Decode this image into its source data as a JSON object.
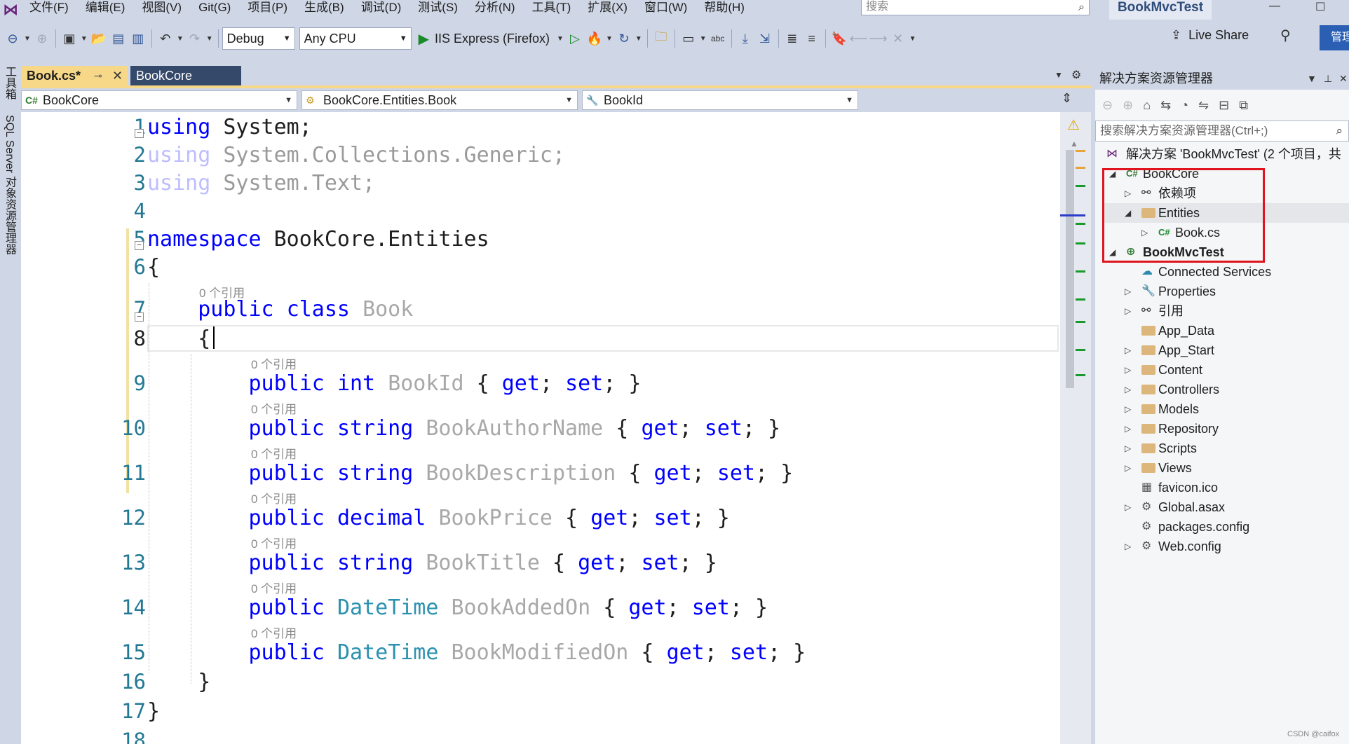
{
  "menu": [
    "文件(F)",
    "编辑(E)",
    "视图(V)",
    "Git(G)",
    "项目(P)",
    "生成(B)",
    "调试(D)",
    "测试(S)",
    "分析(N)",
    "工具(T)",
    "扩展(X)",
    "窗口(W)",
    "帮助(H)"
  ],
  "search_placeholder": "搜索",
  "solution_name": "BookMvcTest",
  "toolbar": {
    "config": "Debug",
    "platform": "Any CPU",
    "run_target": "IIS Express (Firefox)",
    "live_share": "Live Share",
    "admin": "管理"
  },
  "left_strip": [
    "工具箱",
    "SQL Server 对象资源管理器"
  ],
  "tabs": [
    {
      "label": "Book.cs*",
      "active": true
    },
    {
      "label": "BookCore",
      "active": false
    }
  ],
  "navbar": {
    "project": "BookCore",
    "type": "BookCore.Entities.Book",
    "member": "BookId"
  },
  "code_lens": "0 个引用",
  "code_lines": [
    {
      "n": "1",
      "segs": [
        [
          "kw",
          "using"
        ],
        [
          "t",
          " System;"
        ]
      ]
    },
    {
      "n": "2",
      "segs": [
        [
          "dimkw",
          "using"
        ],
        [
          "dim",
          " System.Collections.Generic;"
        ]
      ]
    },
    {
      "n": "3",
      "segs": [
        [
          "dimkw",
          "using"
        ],
        [
          "dim",
          " System.Text;"
        ]
      ]
    },
    {
      "n": "4",
      "segs": []
    },
    {
      "n": "5",
      "segs": [
        [
          "kw",
          "namespace"
        ],
        [
          "t",
          " BookCore.Entities"
        ]
      ]
    },
    {
      "n": "6",
      "segs": [
        [
          "t",
          "{"
        ]
      ]
    },
    {
      "n": "7",
      "segs": [
        [
          "t",
          "    "
        ],
        [
          "kw",
          "public"
        ],
        [
          "t",
          " "
        ],
        [
          "kw",
          "class"
        ],
        [
          "t",
          " "
        ],
        [
          "prop",
          "Book"
        ]
      ]
    },
    {
      "n": "8",
      "segs": [
        [
          "t",
          "    {"
        ]
      ]
    },
    {
      "n": "9",
      "segs": [
        [
          "t",
          "        "
        ],
        [
          "kw",
          "public"
        ],
        [
          "t",
          " "
        ],
        [
          "kw",
          "int"
        ],
        [
          "t",
          " "
        ],
        [
          "prop",
          "BookId"
        ],
        [
          "t",
          " { "
        ],
        [
          "kw",
          "get"
        ],
        [
          "t",
          "; "
        ],
        [
          "kw",
          "set"
        ],
        [
          "t",
          "; }"
        ]
      ]
    },
    {
      "n": "10",
      "segs": [
        [
          "t",
          "        "
        ],
        [
          "kw",
          "public"
        ],
        [
          "t",
          " "
        ],
        [
          "kw",
          "string"
        ],
        [
          "t",
          " "
        ],
        [
          "prop",
          "BookAuthorName"
        ],
        [
          "t",
          " { "
        ],
        [
          "kw",
          "get"
        ],
        [
          "t",
          "; "
        ],
        [
          "kw",
          "set"
        ],
        [
          "t",
          "; }"
        ]
      ]
    },
    {
      "n": "11",
      "segs": [
        [
          "t",
          "        "
        ],
        [
          "kw",
          "public"
        ],
        [
          "t",
          " "
        ],
        [
          "kw",
          "string"
        ],
        [
          "t",
          " "
        ],
        [
          "prop",
          "BookDescription"
        ],
        [
          "t",
          " { "
        ],
        [
          "kw",
          "get"
        ],
        [
          "t",
          "; "
        ],
        [
          "kw",
          "set"
        ],
        [
          "t",
          "; }"
        ]
      ]
    },
    {
      "n": "12",
      "segs": [
        [
          "t",
          "        "
        ],
        [
          "kw",
          "public"
        ],
        [
          "t",
          " "
        ],
        [
          "kw",
          "decimal"
        ],
        [
          "t",
          " "
        ],
        [
          "prop",
          "BookPrice"
        ],
        [
          "t",
          " { "
        ],
        [
          "kw",
          "get"
        ],
        [
          "t",
          "; "
        ],
        [
          "kw",
          "set"
        ],
        [
          "t",
          "; }"
        ]
      ]
    },
    {
      "n": "13",
      "segs": [
        [
          "t",
          "        "
        ],
        [
          "kw",
          "public"
        ],
        [
          "t",
          " "
        ],
        [
          "kw",
          "string"
        ],
        [
          "t",
          " "
        ],
        [
          "prop",
          "BookTitle"
        ],
        [
          "t",
          " { "
        ],
        [
          "kw",
          "get"
        ],
        [
          "t",
          "; "
        ],
        [
          "kw",
          "set"
        ],
        [
          "t",
          "; }"
        ]
      ]
    },
    {
      "n": "14",
      "segs": [
        [
          "t",
          "        "
        ],
        [
          "kw",
          "public"
        ],
        [
          "t",
          " "
        ],
        [
          "type",
          "DateTime"
        ],
        [
          "t",
          " "
        ],
        [
          "prop",
          "BookAddedOn"
        ],
        [
          "t",
          " { "
        ],
        [
          "kw",
          "get"
        ],
        [
          "t",
          "; "
        ],
        [
          "kw",
          "set"
        ],
        [
          "t",
          "; }"
        ]
      ]
    },
    {
      "n": "15",
      "segs": [
        [
          "t",
          "        "
        ],
        [
          "kw",
          "public"
        ],
        [
          "t",
          " "
        ],
        [
          "type",
          "DateTime"
        ],
        [
          "t",
          " "
        ],
        [
          "prop",
          "BookModifiedOn"
        ],
        [
          "t",
          " { "
        ],
        [
          "kw",
          "get"
        ],
        [
          "t",
          "; "
        ],
        [
          "kw",
          "set"
        ],
        [
          "t",
          "; }"
        ]
      ]
    },
    {
      "n": "16",
      "segs": [
        [
          "t",
          "    }"
        ]
      ]
    },
    {
      "n": "17",
      "segs": [
        [
          "t",
          "}"
        ]
      ]
    },
    {
      "n": "18",
      "segs": []
    }
  ],
  "solution_explorer": {
    "title": "解决方案资源管理器",
    "search_placeholder": "搜索解决方案资源管理器(Ctrl+;)",
    "solution_label": "解决方案 'BookMvcTest' (2 个项目，共",
    "items": [
      {
        "label": "BookCore",
        "icon": "csharp-project-icon"
      },
      {
        "label": "依赖项",
        "icon": "dependencies-icon"
      },
      {
        "label": "Entities",
        "icon": "folder-icon"
      },
      {
        "label": "Book.cs",
        "icon": "csharp-file-icon"
      },
      {
        "label": "BookMvcTest",
        "icon": "web-project-icon"
      },
      {
        "label": "Connected Services",
        "icon": "connected-services-icon"
      },
      {
        "label": "Properties",
        "icon": "wrench-icon"
      },
      {
        "label": "引用",
        "icon": "references-icon"
      },
      {
        "label": "App_Data",
        "icon": "folder-icon"
      },
      {
        "label": "App_Start",
        "icon": "folder-icon"
      },
      {
        "label": "Content",
        "icon": "folder-icon"
      },
      {
        "label": "Controllers",
        "icon": "folder-icon"
      },
      {
        "label": "Models",
        "icon": "folder-icon"
      },
      {
        "label": "Repository",
        "icon": "folder-icon"
      },
      {
        "label": "Scripts",
        "icon": "folder-icon"
      },
      {
        "label": "Views",
        "icon": "folder-icon"
      },
      {
        "label": "favicon.ico",
        "icon": "image-file-icon"
      },
      {
        "label": "Global.asax",
        "icon": "config-file-icon"
      },
      {
        "label": "packages.config",
        "icon": "config-file-icon"
      },
      {
        "label": "Web.config",
        "icon": "config-file-icon"
      }
    ]
  },
  "watermark": "CSDN @caifox",
  "colors": {
    "keyword": "#0000ff",
    "type": "#2b91af",
    "highlight": "#e0141e",
    "active_tab": "#f7d889"
  }
}
